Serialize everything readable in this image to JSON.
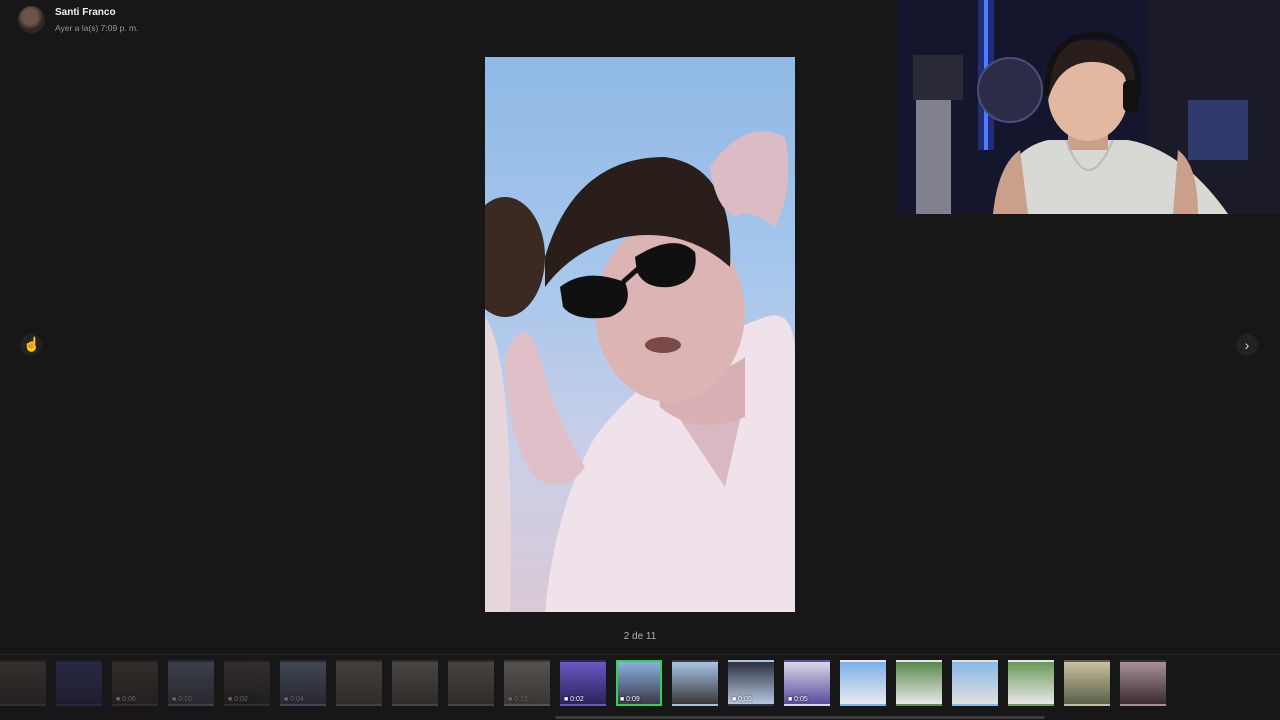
{
  "header": {
    "sender_name": "Santi Franco",
    "timestamp": "Ayer a la(s) 7:09 p. m."
  },
  "viewer": {
    "counter": "2 de 11",
    "prev_icon": "chevron-left-icon",
    "next_icon": "chevron-right-icon"
  },
  "thumbnails": [
    {
      "type": "photo",
      "duration": "",
      "dim": true,
      "colors": [
        "#6b5a55",
        "#3b3230"
      ]
    },
    {
      "type": "photo",
      "duration": "",
      "dim": true,
      "colors": [
        "#4b4a9a",
        "#2a285c"
      ]
    },
    {
      "type": "video",
      "duration": "0:06",
      "dim": true,
      "colors": [
        "#6a5651",
        "#3a302e"
      ]
    },
    {
      "type": "video",
      "duration": "0:10",
      "dim": true,
      "colors": [
        "#7c8aa8",
        "#4d4a5c"
      ]
    },
    {
      "type": "video",
      "duration": "0:02",
      "dim": true,
      "colors": [
        "#6a5a56",
        "#302a2a"
      ]
    },
    {
      "type": "video",
      "duration": "0:04",
      "dim": true,
      "colors": [
        "#8aa0c6",
        "#4a4a5a"
      ]
    },
    {
      "type": "photo",
      "duration": "",
      "dim": true,
      "colors": [
        "#9a8a80",
        "#5a514c"
      ]
    },
    {
      "type": "photo",
      "duration": "",
      "dim": true,
      "colors": [
        "#a09890",
        "#5c5450"
      ]
    },
    {
      "type": "photo",
      "duration": "",
      "dim": true,
      "colors": [
        "#a0968c",
        "#5a524a"
      ]
    },
    {
      "type": "video",
      "duration": "0:15",
      "dim": true,
      "colors": [
        "#c8c0b8",
        "#7a7068"
      ]
    },
    {
      "type": "video",
      "duration": "0:02",
      "dim": false,
      "colors": [
        "#6a58c0",
        "#2a2460"
      ]
    },
    {
      "type": "video",
      "duration": "0:09",
      "dim": false,
      "active": true,
      "colors": [
        "#8ab0e0",
        "#3a3a4a"
      ]
    },
    {
      "type": "photo",
      "duration": "",
      "dim": false,
      "colors": [
        "#a8c4e8",
        "#3a3838"
      ]
    },
    {
      "type": "video",
      "duration": "0:05",
      "dim": false,
      "colors": [
        "#2a3040",
        "#b8c8e0"
      ]
    },
    {
      "type": "video",
      "duration": "0:05",
      "dim": false,
      "colors": [
        "#d8d8e8",
        "#5a4a9a"
      ]
    },
    {
      "type": "photo",
      "duration": "",
      "dim": false,
      "colors": [
        "#7ab0e8",
        "#e8e8f0"
      ]
    },
    {
      "type": "photo",
      "duration": "",
      "dim": false,
      "colors": [
        "#5a8a4a",
        "#e8e8e8"
      ]
    },
    {
      "type": "photo",
      "duration": "",
      "dim": false,
      "colors": [
        "#88b8e8",
        "#e0e0e0"
      ]
    },
    {
      "type": "photo",
      "duration": "",
      "dim": false,
      "colors": [
        "#6a9a58",
        "#e8e8e8"
      ]
    },
    {
      "type": "photo",
      "duration": "",
      "dim": false,
      "colors": [
        "#c8c0a0",
        "#5a6048"
      ]
    },
    {
      "type": "photo",
      "duration": "",
      "dim": false,
      "colors": [
        "#a8909a",
        "#3a2a30"
      ]
    }
  ],
  "colors": {
    "background": "#171717",
    "active_thumbnail_border": "#2fd15a"
  }
}
